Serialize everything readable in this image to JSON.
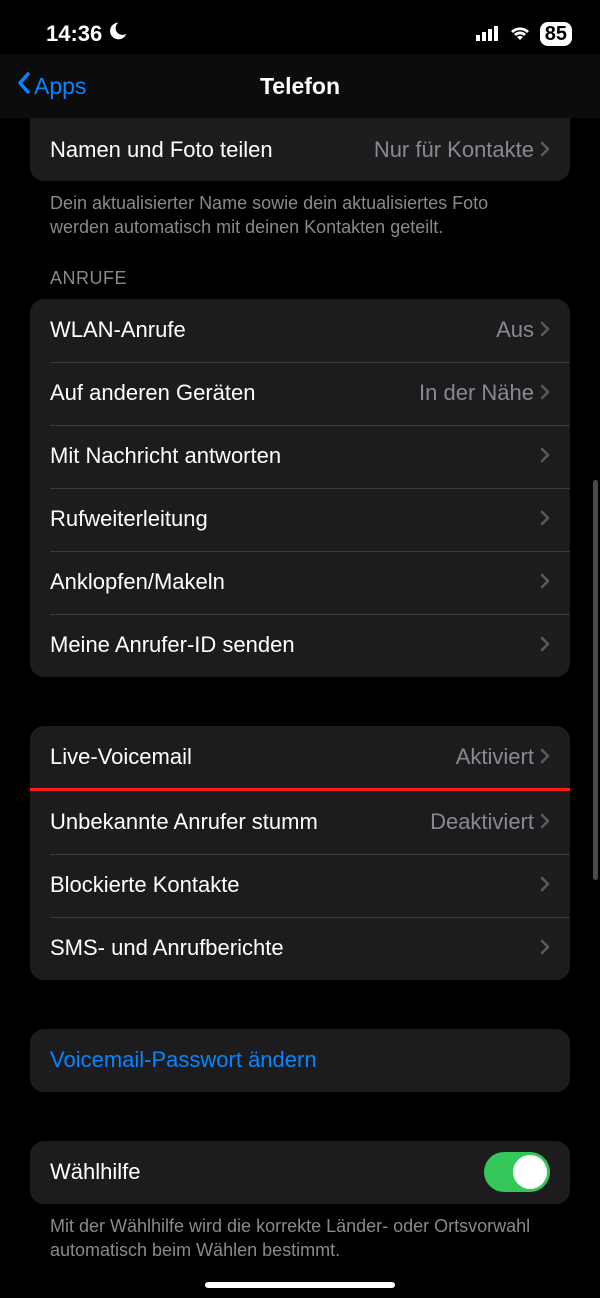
{
  "status": {
    "time": "14:36",
    "battery": "85"
  },
  "nav": {
    "back": "Apps",
    "title": "Telefon"
  },
  "top_group": {
    "item": {
      "label": "Namen und Foto teilen",
      "value": "Nur für Kontakte"
    },
    "footer": "Dein aktualisierter Name sowie dein aktualisiertes Foto werden automatisch mit deinen Kontakten geteilt."
  },
  "anrufe": {
    "header": "ANRUFE",
    "items": [
      {
        "label": "WLAN-Anrufe",
        "value": "Aus"
      },
      {
        "label": "Auf anderen Geräten",
        "value": "In der Nähe"
      },
      {
        "label": "Mit Nachricht antworten",
        "value": ""
      },
      {
        "label": "Rufweiterleitung",
        "value": ""
      },
      {
        "label": "Anklopfen/Makeln",
        "value": ""
      },
      {
        "label": "Meine Anrufer-ID senden",
        "value": ""
      }
    ]
  },
  "voicemail_group": {
    "items": [
      {
        "label": "Live-Voicemail",
        "value": "Aktiviert",
        "highlight": true
      },
      {
        "label": "Unbekannte Anrufer stumm",
        "value": "Deaktiviert"
      },
      {
        "label": "Blockierte Kontakte",
        "value": ""
      },
      {
        "label": "SMS- und Anrufberichte",
        "value": ""
      }
    ]
  },
  "password_group": {
    "label": "Voicemail-Passwort ändern"
  },
  "dial_group": {
    "label": "Wählhilfe",
    "toggle": true,
    "footer": "Mit der Wählhilfe wird die korrekte Länder- oder Ortsvorwahl automatisch beim Wählen bestimmt."
  }
}
